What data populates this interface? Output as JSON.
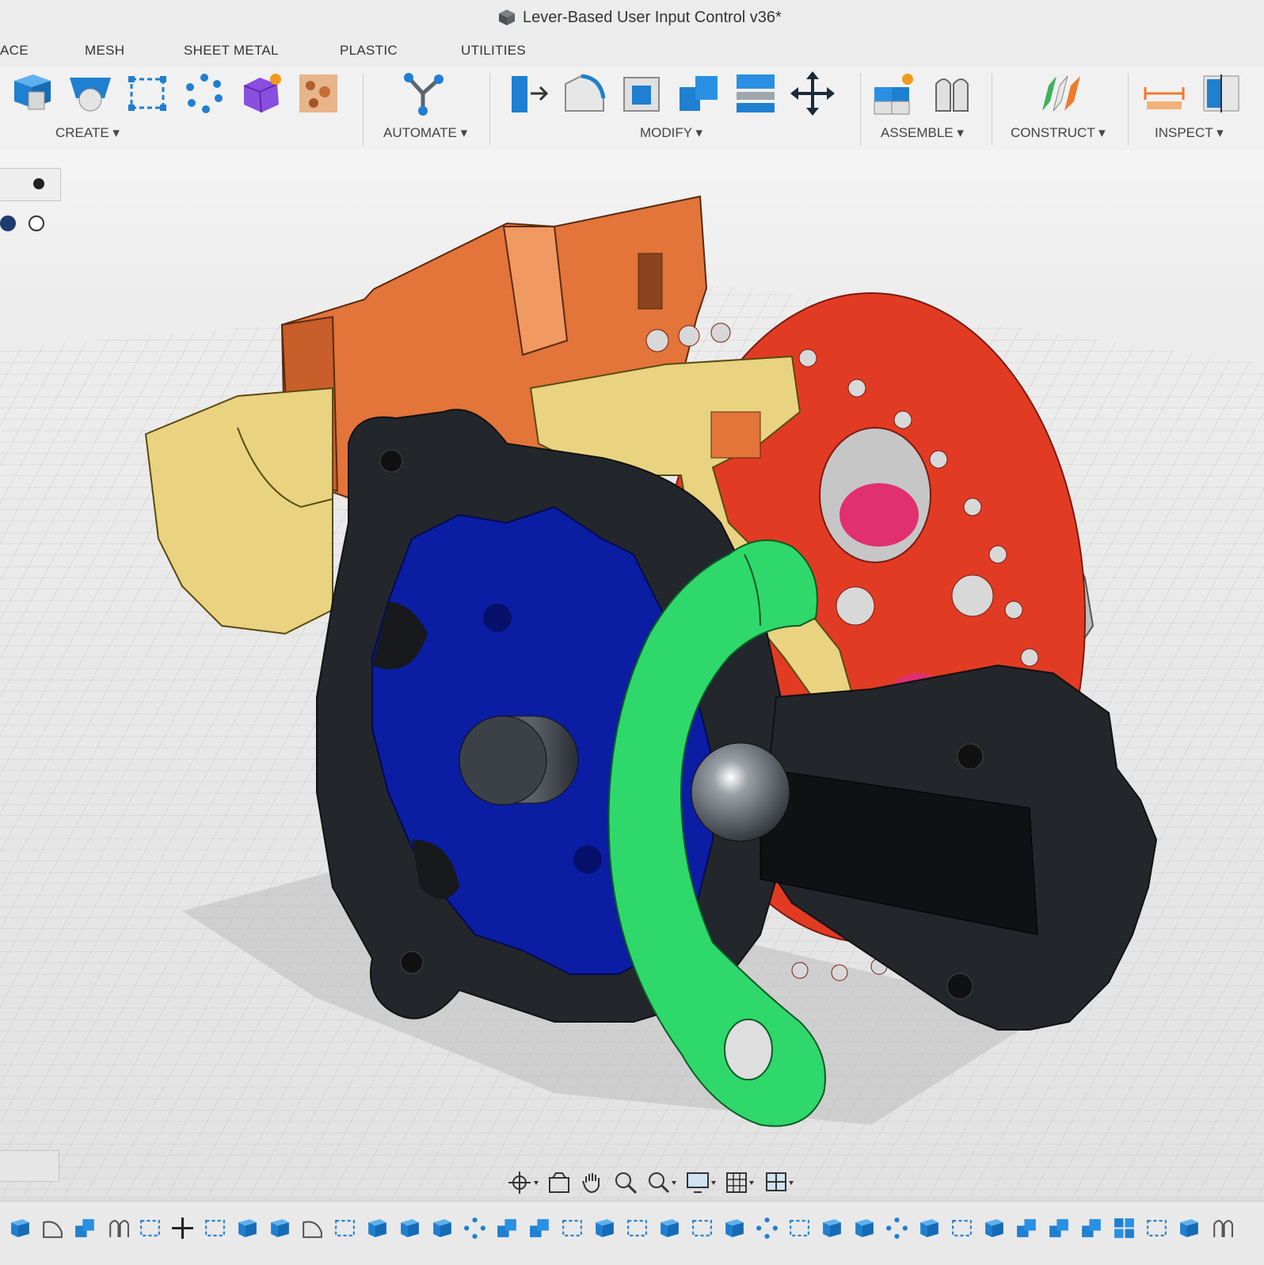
{
  "window": {
    "title": "Lever-Based User Input Control v36*"
  },
  "tabs": [
    "ACE",
    "MESH",
    "SHEET METAL",
    "PLASTIC",
    "UTILITIES"
  ],
  "ribbon": {
    "create_label": "CREATE ▾",
    "automate_label": "AUTOMATE ▾",
    "modify_label": "MODIFY ▾",
    "assemble_label": "ASSEMBLE ▾",
    "construct_label": "CONSTRUCT ▾",
    "inspect_label": "INSPECT ▾"
  },
  "model": {
    "parts": [
      "orange-bracket",
      "yellow-housing",
      "red-sprocket",
      "blue-detent-wheel",
      "black-housing",
      "green-lever",
      "steel-ball",
      "steel-pin"
    ]
  },
  "colors": {
    "accent_blue": "#1f7fd0",
    "orange": "#e3743a",
    "yellow": "#e9d381",
    "red": "#e23b24",
    "blue": "#0b1ea3",
    "black": "#23272c",
    "green": "#2fd86a"
  },
  "timeline": {
    "count": 38
  }
}
